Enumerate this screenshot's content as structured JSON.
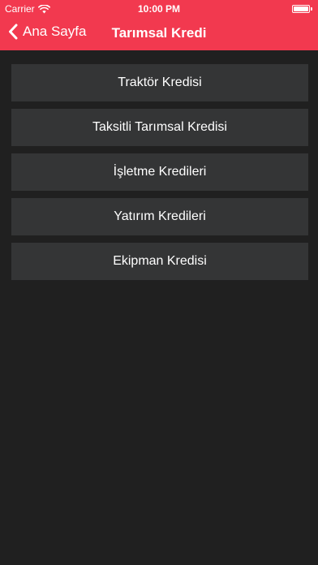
{
  "status_bar": {
    "carrier": "Carrier",
    "time": "10:00 PM",
    "wifi_icon": "wifi-icon",
    "battery_level": 1.0
  },
  "nav": {
    "back_label": "Ana Sayfa",
    "back_icon": "chevron-left-icon",
    "title": "Tarımsal Kredi",
    "accent_color": "#f2394f"
  },
  "menu": {
    "items": [
      {
        "label": "Traktör Kredisi"
      },
      {
        "label": "Taksitli Tarımsal Kredisi"
      },
      {
        "label": "İşletme Kredileri"
      },
      {
        "label": "Yatırım Kredileri"
      },
      {
        "label": "Ekipman Kredisi"
      }
    ]
  },
  "colors": {
    "background": "#202020",
    "button_background": "#343536",
    "text": "#ffffff"
  }
}
